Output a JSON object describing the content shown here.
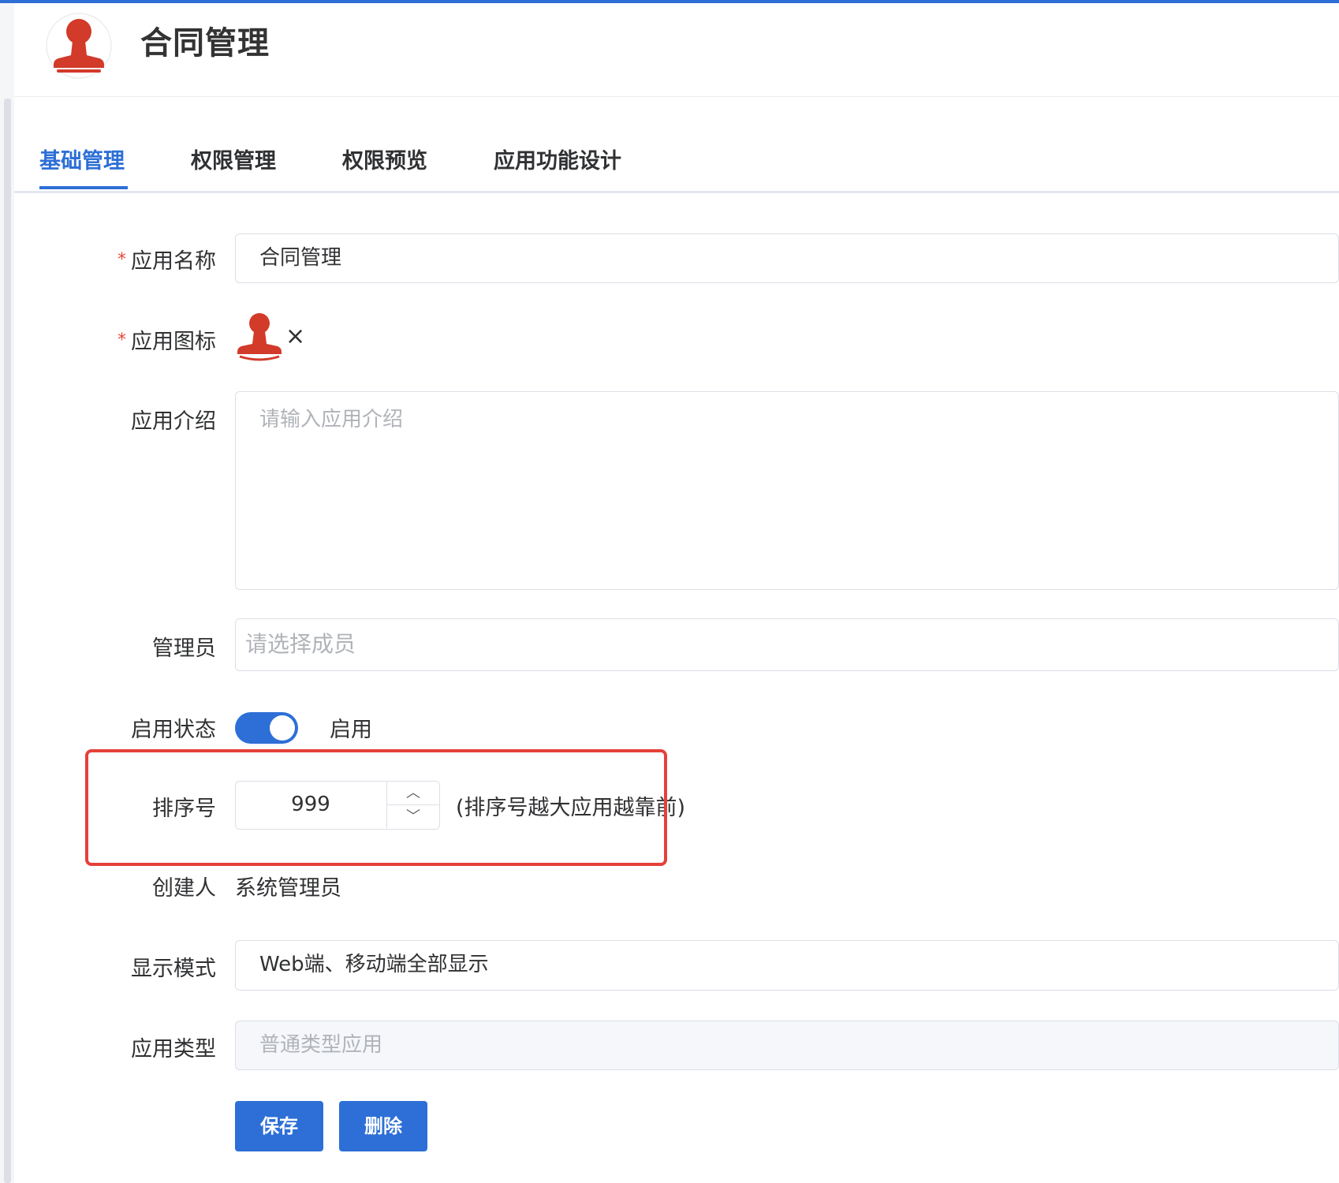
{
  "colors": {
    "accent": "#2d6fd6",
    "required": "#e5473d",
    "highlight": "#e5403a",
    "stamp": "#d23a2a"
  },
  "header": {
    "title": "合同管理",
    "logo_icon": "red-stamp-icon"
  },
  "tabs": [
    {
      "label": "基础管理",
      "active": true
    },
    {
      "label": "权限管理",
      "active": false
    },
    {
      "label": "权限预览",
      "active": false
    },
    {
      "label": "应用功能设计",
      "active": false
    }
  ],
  "form": {
    "required_mark": "*",
    "app_name": {
      "label": "应用名称",
      "value": "合同管理"
    },
    "app_icon": {
      "label": "应用图标",
      "icon": "red-stamp-icon",
      "remove_glyph": "×"
    },
    "app_intro": {
      "label": "应用介绍",
      "placeholder": "请输入应用介绍"
    },
    "admin": {
      "label": "管理员",
      "placeholder": "请选择成员"
    },
    "status": {
      "label": "启用状态",
      "on": true,
      "text": "启用"
    },
    "sort": {
      "label": "排序号",
      "value": "999",
      "up_glyph": "︿",
      "down_glyph": "﹀",
      "hint": "(排序号越大应用越靠前)"
    },
    "creator": {
      "label": "创建人",
      "value": "系统管理员"
    },
    "display_mode": {
      "label": "显示模式",
      "value": "Web端、移动端全部显示"
    },
    "app_type": {
      "label": "应用类型",
      "value": "普通类型应用"
    }
  },
  "actions": {
    "save_label": "保存",
    "delete_label": "删除"
  }
}
